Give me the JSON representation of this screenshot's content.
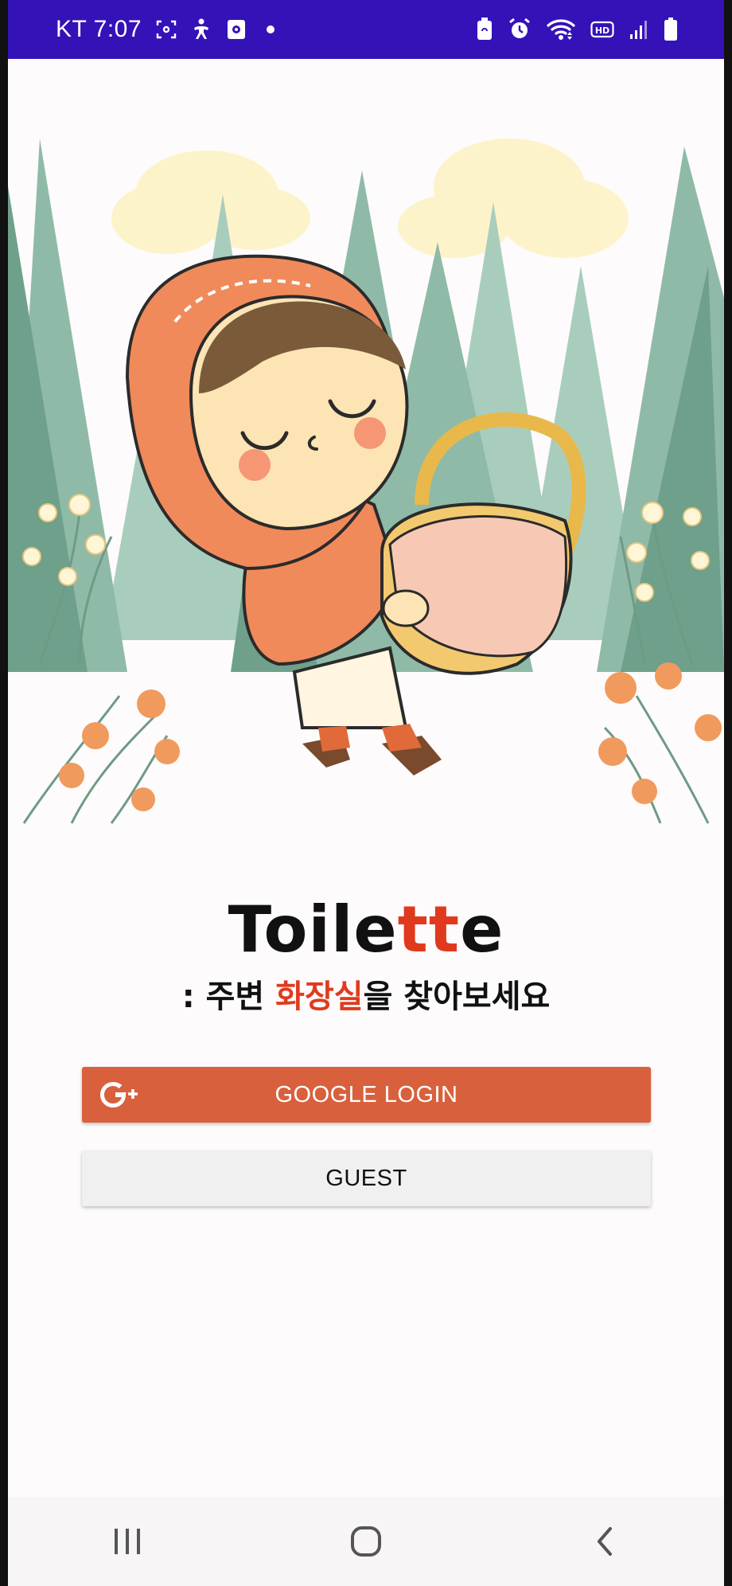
{
  "status_bar": {
    "carrier": "KT",
    "time": "7:07",
    "background_color": "#3512b8",
    "left_icons": [
      "screenshot-icon",
      "accessibility-icon",
      "media-icon",
      "notification-dot-icon"
    ],
    "right_icons": [
      "battery-saver-icon",
      "alarm-icon",
      "wifi-icon",
      "hd-voice-icon",
      "signal-icon",
      "battery-icon"
    ],
    "hd_label": "HD"
  },
  "header_image": {
    "description_icon": "little-red-riding-hood-illustration"
  },
  "app": {
    "title_main": "Toile",
    "title_accent": "tt",
    "title_end": "e",
    "subtitle_prefix": ": 주변 ",
    "subtitle_accent": "화장실",
    "subtitle_suffix": "을 찾아보세요",
    "accent_color": "#e03a1e"
  },
  "buttons": {
    "google_login": "GOOGLE LOGIN",
    "google_icon": "google-plus-icon",
    "google_color": "#d9603d",
    "guest": "GUEST"
  },
  "nav_bar": {
    "items": [
      "recent-apps-icon",
      "home-icon",
      "back-icon"
    ]
  }
}
